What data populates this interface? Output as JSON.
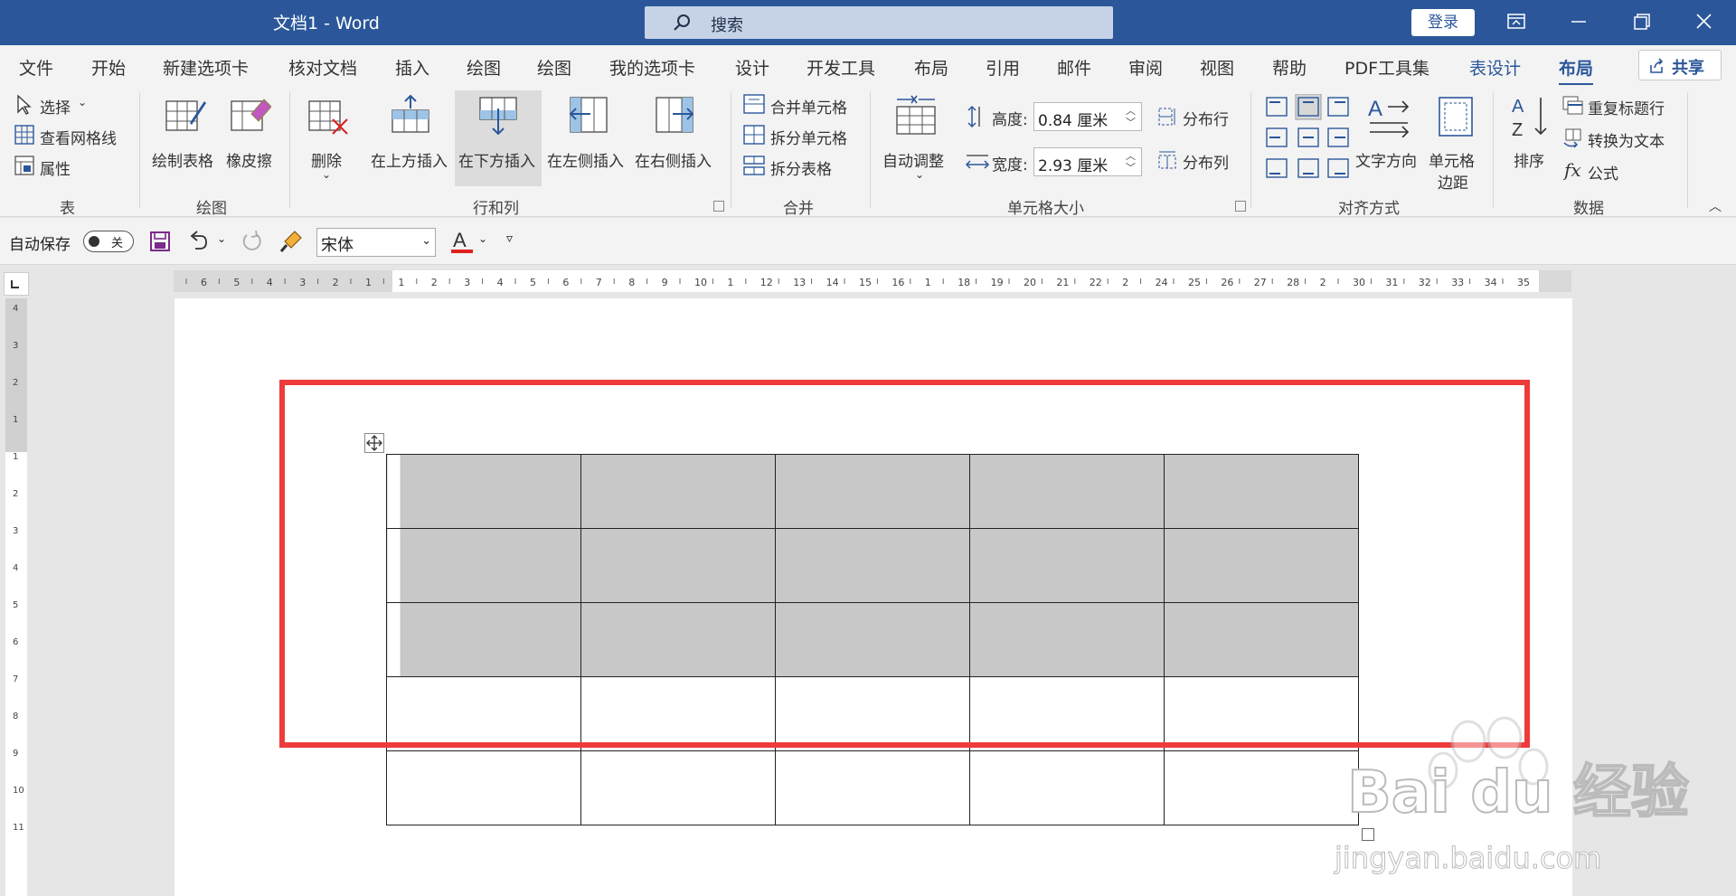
{
  "title_bar": {
    "title": "文档1  -  Word",
    "search_placeholder": "搜索",
    "login_label": "登录"
  },
  "tabs": [
    "文件",
    "开始",
    "新建选项卡",
    "核对文档",
    "插入",
    "绘图",
    "绘图",
    "我的选项卡",
    "设计",
    "开发工具",
    "布局",
    "引用",
    "邮件",
    "审阅",
    "视图",
    "帮助",
    "PDF工具集",
    "表设计",
    "布局"
  ],
  "share_label": "共享",
  "ribbon": {
    "table_group": {
      "select": "选择",
      "view_gridlines": "查看网格线",
      "properties": "属性",
      "label": "表"
    },
    "draw_group": {
      "draw_table": "绘制表格",
      "eraser": "橡皮擦",
      "label": "绘图"
    },
    "rows_cols_group": {
      "delete": "删除",
      "insert_above": "在上方插入",
      "insert_below": "在下方插入",
      "insert_left": "在左侧插入",
      "insert_right": "在右侧插入",
      "label": "行和列"
    },
    "merge_group": {
      "merge_cells": "合并单元格",
      "split_cells": "拆分单元格",
      "split_table": "拆分表格",
      "label": "合并"
    },
    "cell_size_group": {
      "autofit": "自动调整",
      "height_label": "高度:",
      "height_value": "0.84 厘米",
      "width_label": "宽度:",
      "width_value": "2.93 厘米",
      "distribute_rows": "分布行",
      "distribute_cols": "分布列",
      "label": "单元格大小"
    },
    "alignment_group": {
      "text_direction": "文字方向",
      "cell_margins_1": "单元格",
      "cell_margins_2": "边距",
      "label": "对齐方式"
    },
    "data_group": {
      "sort": "排序",
      "repeat_header": "重复标题行",
      "convert_to_text": "转换为文本",
      "formula": "公式",
      "label": "数据"
    }
  },
  "qat": {
    "autosave_label": "自动保存",
    "toggle_state": "关",
    "font_name": "宋体"
  },
  "hruler_labels": [
    "6",
    "5",
    "4",
    "3",
    "2",
    "1",
    "1",
    "2",
    "3",
    "4",
    "5",
    "6",
    "7",
    "8",
    "9",
    "10",
    "1",
    "12",
    "13",
    "14",
    "15",
    "16",
    "1",
    "18",
    "19",
    "20",
    "21",
    "22",
    "2",
    "24",
    "25",
    "26",
    "27",
    "28",
    "2",
    "30",
    "31",
    "32",
    "33",
    "34",
    "35"
  ],
  "vruler_labels": [
    "4",
    "3",
    "2",
    "1",
    "1",
    "2",
    "3",
    "4",
    "5",
    "6",
    "7",
    "8",
    "9",
    "10",
    "11"
  ],
  "table": {
    "rows": 5,
    "cols": 5,
    "selected_rows": [
      0,
      1,
      2
    ]
  },
  "watermark": {
    "text": "Bai du 经验",
    "url": "jingyan.baidu.com"
  },
  "colors": {
    "title_bar": "#2b579a",
    "highlight_box": "#ee3b3b",
    "selection": "#c8c8c8"
  }
}
